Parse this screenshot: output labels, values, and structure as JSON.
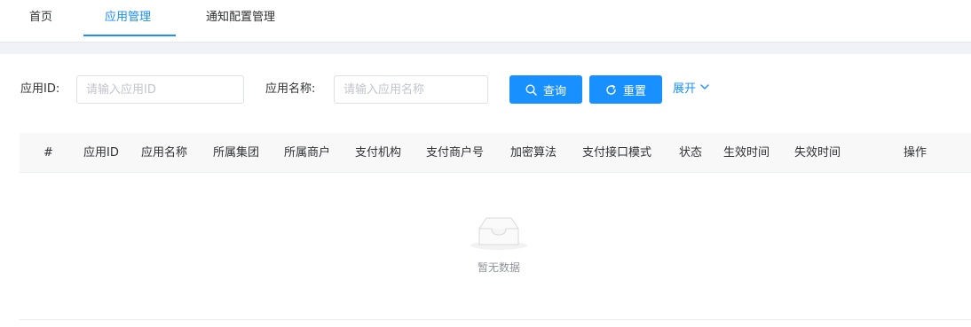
{
  "tabs": [
    {
      "label": "首页",
      "active": false
    },
    {
      "label": "应用管理",
      "active": true
    },
    {
      "label": "通知配置管理",
      "active": false
    }
  ],
  "search": {
    "app_id_label": "应用ID:",
    "app_id_placeholder": "请输入应用ID",
    "app_name_label": "应用名称:",
    "app_name_placeholder": "请输入应用名称",
    "query_label": "查询",
    "reset_label": "重置",
    "expand_label": "展开"
  },
  "table": {
    "columns": [
      "#",
      "应用ID",
      "应用名称",
      "所属集团",
      "所属商户",
      "支付机构",
      "支付商户号",
      "加密算法",
      "支付接口模式",
      "状态",
      "生效时间",
      "失效时间",
      "操作"
    ],
    "rows": [],
    "empty_text": "暂无数据"
  },
  "colors": {
    "primary": "#1890ff",
    "border": "#dcdfe6",
    "header_bg": "#f8f8f9",
    "page_band": "#f0f2f5"
  }
}
